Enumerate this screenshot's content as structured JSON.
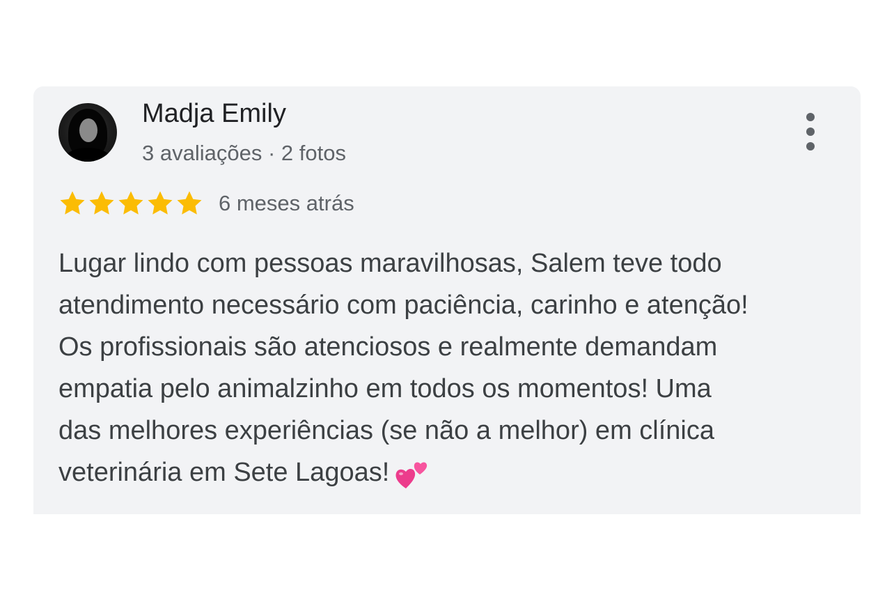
{
  "review": {
    "author_name": "Madja Emily",
    "author_meta": "3 avaliações · 2 fotos",
    "rating": 5,
    "rating_max": 5,
    "star_color": "#fbbc04",
    "time_ago": "6 meses atrás",
    "text_lines": [
      "Lugar lindo com pessoas maravilhosas, Salem teve todo",
      "atendimento necessário com paciência, carinho e atenção!",
      "Os profissionais são atenciosos e realmente demandam",
      "empatia pelo animalzinho em todos os momentos! Uma",
      "das melhores experiências (se não a melhor) em clínica",
      "veterinária em Sete Lagoas!"
    ],
    "emoji": "two-hearts-emoji",
    "menu_icon": "more-vert-icon",
    "avatar_icon": "user-photo-avatar"
  }
}
